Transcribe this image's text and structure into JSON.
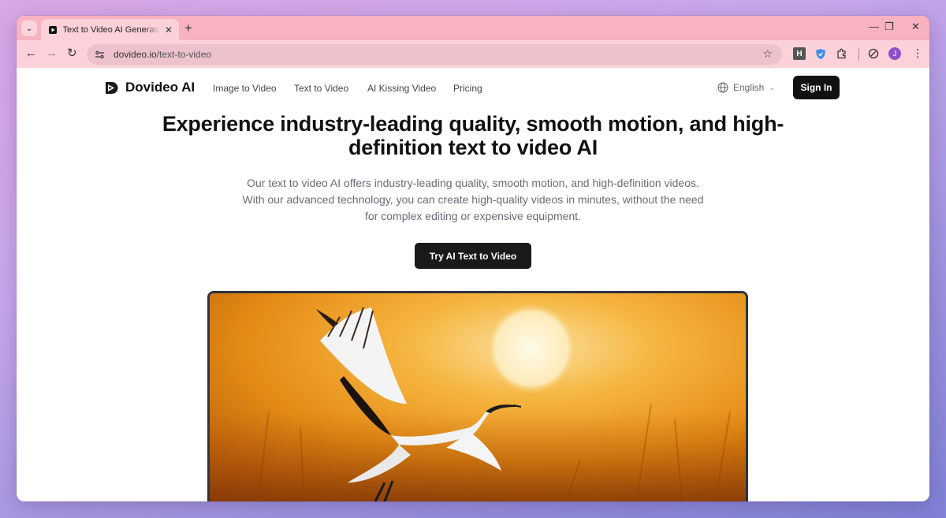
{
  "browser": {
    "tab": {
      "title": "Text to Video AI Generator: Turn"
    },
    "address": {
      "domain": "dovideo.io",
      "path": "/text-to-video"
    },
    "extensions": {
      "h_label": "H",
      "profile_initial": "J"
    }
  },
  "site": {
    "brand": "Dovideo AI",
    "nav": [
      "Image to Video",
      "Text to Video",
      "AI Kissing Video",
      "Pricing"
    ],
    "language": "English",
    "signin_label": "Sign In"
  },
  "hero": {
    "title": "Experience industry-leading quality, smooth motion, and high-definition text to video AI",
    "description": "Our text to video AI offers industry-leading quality, smooth motion, and high-definition videos. With our advanced technology, you can create high-quality videos in minutes, without the need for complex editing or expensive equipment.",
    "cta_label": "Try AI Text to Video"
  },
  "colors": {
    "tabstrip": "#f9b2c0",
    "toolbar": "#fdd1da",
    "button_dark": "#111111",
    "sunset_orange": "#e8901a"
  }
}
